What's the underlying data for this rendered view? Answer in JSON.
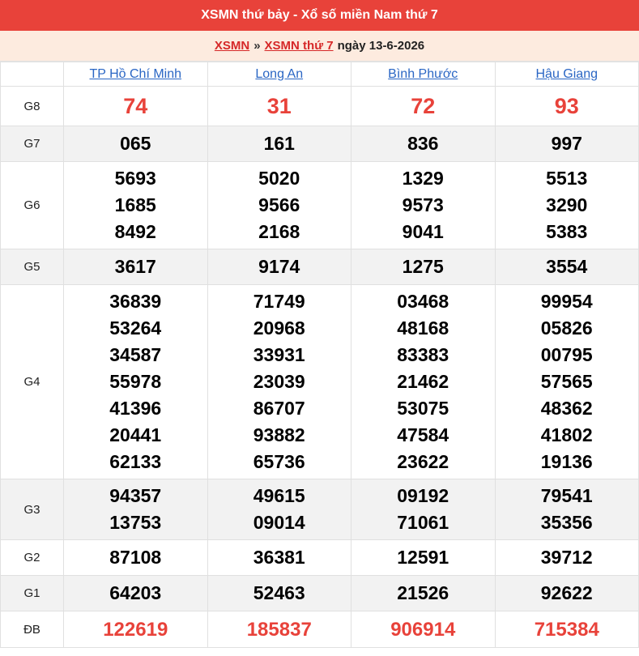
{
  "header": {
    "title": "XSMN thứ bảy - Xổ số miền Nam thứ 7",
    "crumb_link1": "XSMN",
    "crumb_sep": "»",
    "crumb_link2": "XSMN thứ 7",
    "crumb_date": "ngày 13-6-2026"
  },
  "provinces": [
    "TP Hồ Chí Minh",
    "Long An",
    "Bình Phước",
    "Hậu Giang"
  ],
  "prizes": [
    {
      "label": "G8",
      "values": [
        [
          "74"
        ],
        [
          "31"
        ],
        [
          "72"
        ],
        [
          "93"
        ]
      ]
    },
    {
      "label": "G7",
      "values": [
        [
          "065"
        ],
        [
          "161"
        ],
        [
          "836"
        ],
        [
          "997"
        ]
      ]
    },
    {
      "label": "G6",
      "values": [
        [
          "5693",
          "1685",
          "8492"
        ],
        [
          "5020",
          "9566",
          "2168"
        ],
        [
          "1329",
          "9573",
          "9041"
        ],
        [
          "5513",
          "3290",
          "5383"
        ]
      ]
    },
    {
      "label": "G5",
      "values": [
        [
          "3617"
        ],
        [
          "9174"
        ],
        [
          "1275"
        ],
        [
          "3554"
        ]
      ]
    },
    {
      "label": "G4",
      "values": [
        [
          "36839",
          "53264",
          "34587",
          "55978",
          "41396",
          "20441",
          "62133"
        ],
        [
          "71749",
          "20968",
          "33931",
          "23039",
          "86707",
          "93882",
          "65736"
        ],
        [
          "03468",
          "48168",
          "83383",
          "21462",
          "53075",
          "47584",
          "23622"
        ],
        [
          "99954",
          "05826",
          "00795",
          "57565",
          "48362",
          "41802",
          "19136"
        ]
      ]
    },
    {
      "label": "G3",
      "values": [
        [
          "94357",
          "13753"
        ],
        [
          "49615",
          "09014"
        ],
        [
          "09192",
          "71061"
        ],
        [
          "79541",
          "35356"
        ]
      ]
    },
    {
      "label": "G2",
      "values": [
        [
          "87108"
        ],
        [
          "36381"
        ],
        [
          "12591"
        ],
        [
          "39712"
        ]
      ]
    },
    {
      "label": "G1",
      "values": [
        [
          "64203"
        ],
        [
          "52463"
        ],
        [
          "21526"
        ],
        [
          "92622"
        ]
      ]
    },
    {
      "label": "ĐB",
      "values": [
        [
          "122619"
        ],
        [
          "185837"
        ],
        [
          "906914"
        ],
        [
          "715384"
        ]
      ]
    }
  ],
  "colors": {
    "accent": "#e8423a",
    "link": "#2a66c4",
    "crumb_bg": "#fdebdf",
    "shade": "#f2f2f2"
  }
}
